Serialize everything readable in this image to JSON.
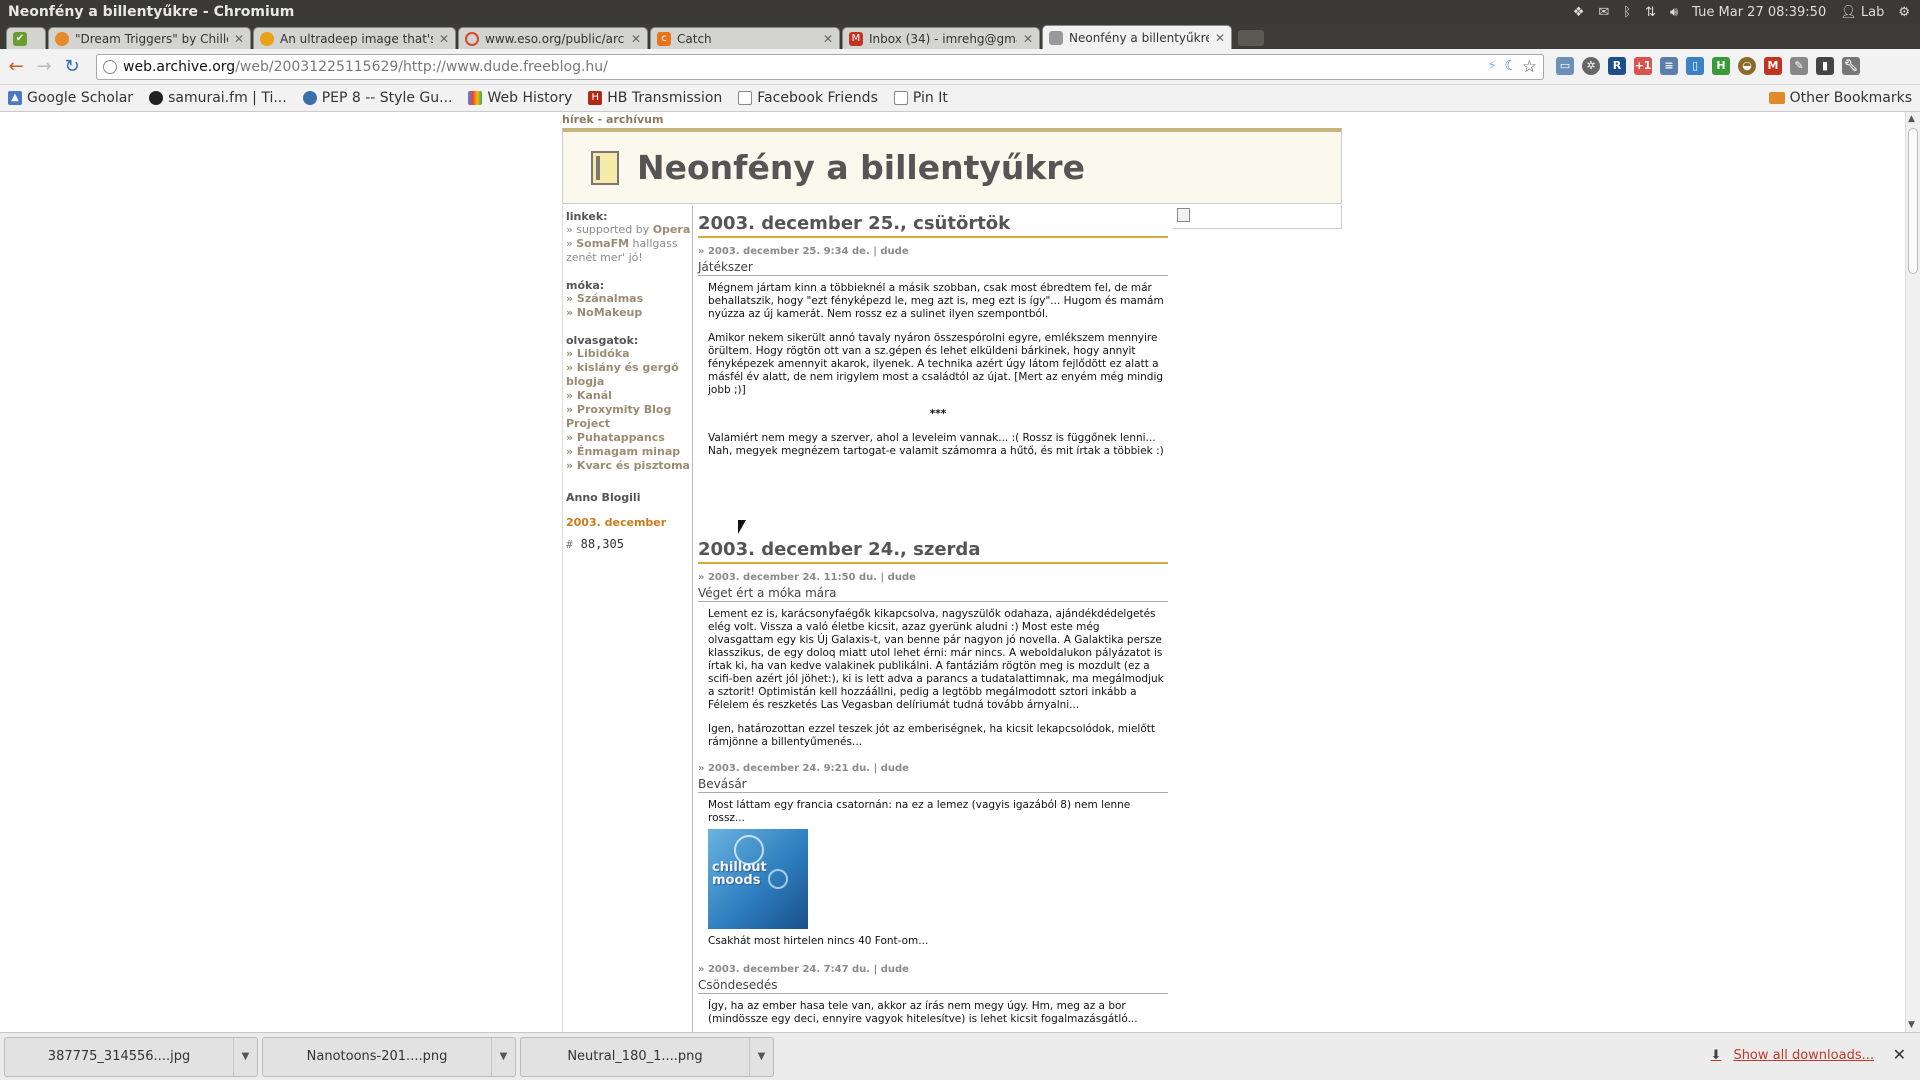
{
  "window": {
    "title": "Neonfény a billentyűkre - Chromium"
  },
  "system": {
    "clock": "Tue Mar 27 08:39:50",
    "user": "Lab"
  },
  "tabs": [
    {
      "label": "",
      "favicon_color": "#6a9e2c",
      "active": false
    },
    {
      "label": "\"Dream Triggers\" by Chille",
      "favicon_color": "#e8892a",
      "active": false
    },
    {
      "label": "An ultradeep image that's",
      "favicon_color": "#e8a21a",
      "active": false
    },
    {
      "label": "www.eso.org/public/archi",
      "favicon_color": "#d14a2a",
      "active": false
    },
    {
      "label": "Catch",
      "favicon_color": "#e8731a",
      "active": false
    },
    {
      "label": "Inbox (34) - imrehg@gmai",
      "favicon_color": "#c23321",
      "active": false
    },
    {
      "label": "Neonfény a billentyűkre",
      "favicon_color": "#777777",
      "active": true
    }
  ],
  "address": {
    "host": "web.archive.org",
    "path": "/web/20031225115629/http://www.dude.freeblog.hu/"
  },
  "bookmarks": [
    {
      "label": "Google Scholar",
      "icon": "scholar-icon"
    },
    {
      "label": "samurai.fm | Ti...",
      "icon": "samurai-icon"
    },
    {
      "label": "PEP 8 -- Style Gu...",
      "icon": "python-icon"
    },
    {
      "label": "Web History",
      "icon": "google-icon"
    },
    {
      "label": "HB Transmission",
      "icon": "hb-icon"
    },
    {
      "label": "Facebook Friends",
      "icon": "page-icon"
    },
    {
      "label": "Pin It",
      "icon": "page-icon"
    }
  ],
  "other_bookmarks": "Other Bookmarks",
  "blog": {
    "topnav": {
      "news": "hírek",
      "sep": " - ",
      "archive": "archívum"
    },
    "title": "Neonfény a billentyűkre",
    "sidebar": {
      "links_title": "linkek:",
      "links": [
        {
          "pre": "» supported by ",
          "b": "Opera",
          "post": ""
        },
        {
          "pre": "» ",
          "b": "SomaFM",
          "post": " hallgass zenét mer' jó!"
        }
      ],
      "fun_title": "móka:",
      "fun": [
        "» Szánalmas",
        "» NoMakeup"
      ],
      "reading_title": "olvasgatok:",
      "reading": [
        "» Libidóka",
        "» kislány és gergő blogja",
        "» Kanál",
        "» Proxymity Blog Project",
        "» Puhatappancs",
        "» Énmagam minap",
        "» Kvarc és pisztoma"
      ],
      "anno": "Anno Blogili",
      "month": "2003. december",
      "counter_hash": "#",
      "counter": "88,305"
    },
    "days": [
      {
        "heading": "2003. december 25., csütörtök",
        "posts": [
          {
            "meta": "» 2003. december 25. 9:34 de. | dude",
            "title": "Játékszer",
            "paras": [
              "Mégnem jártam kinn a többieknél a másik szobban, csak most ébredtem fel, de már behallatszik, hogy \"ezt fényképezd le, meg azt is, meg ezt is így\"... Hugom és mamám nyúzza az új kamerát. Nem rossz ez a sulinet ilyen szempontból.",
              "Amikor nekem sikerült annó tavaly nyáron összespórolni egyre, emlékszem mennyire örültem. Hogy rögtön ott van a sz.gépen és lehet elküldeni bárkinek, hogy annyit fényképezek amennyit akarok, ilyenek. A technika azért úgy látom fejlődött ez alatt a másfél év alatt, de nem irigylem most a családtól az újat. [Mert az enyém még mindig jobb ;)]",
              "***",
              "Valamiért nem megy a szerver, ahol a leveleim vannak... :( Rossz is függőnek lenni... Nah, megyek megnézem tartogat-e valamit számomra a hűtő, és mit írtak a többiek :)"
            ]
          }
        ]
      },
      {
        "heading": "2003. december 24., szerda",
        "posts": [
          {
            "meta": "» 2003. december 24. 11:50 du. | dude",
            "title": "Véget ért a móka mára",
            "paras": [
              "Lement ez is, karácsonyfaégők kikapcsolva, nagyszülők odahaza, ajándékdédelgetés elég volt. Vissza a való életbe kicsit, azaz gyerünk aludni :) Most este még olvasgattam egy kis Új Galaxis-t, van benne pár nagyon jó novella. A Galaktika persze klasszikus, de egy doloq miatt utol lehet érni: már nincs. A weboldalukon pályázatot is írtak ki, ha van kedve valakinek publikálni. A fantáziám rögtön meg is mozdult (ez a scifi-ben azért jól jöhet:), ki is lett adva a parancs a tudatalattimnak, ma megálmodjuk a sztorit! Optimistán kell hozzáállni, pedig a legtöbb megálmodott sztori inkább a Félelem és reszketés Las Vegasban delíriumát tudná tovább árnyalni...",
              "Igen, határozottan ezzel teszek jót az emberiségnek, ha kicsit lekapcsolódok, mielőtt rámjönne a billentyűmenés..."
            ]
          },
          {
            "meta": "» 2003. december 24. 9:21 du. | dude",
            "title": "Bevásár",
            "paras": [
              "Most láttam egy francia csatornán: na ez a lemez (vagyis igazából 8) nem lenne rossz..."
            ],
            "album_label": "chillout moods",
            "after": "Csakhát most hirtelen nincs 40 Font-om..."
          },
          {
            "meta": "» 2003. december 24. 7:47 du. | dude",
            "title": "Csöndesedés",
            "paras": [
              "Így, ha az ember hasa tele van, akkor az írás nem megy úgy. Hm, meg az a bor (mindössze egy deci, ennyire vagyok hitelesítve) is lehet kicsit fogalmazásgátló..."
            ]
          }
        ]
      }
    ]
  },
  "downloads": [
    {
      "name": "387775_314556....jpg"
    },
    {
      "name": "Nanotoons-201....png"
    },
    {
      "name": "Neutral_180_1....png"
    }
  ],
  "show_all_downloads": "Show all downloads..."
}
